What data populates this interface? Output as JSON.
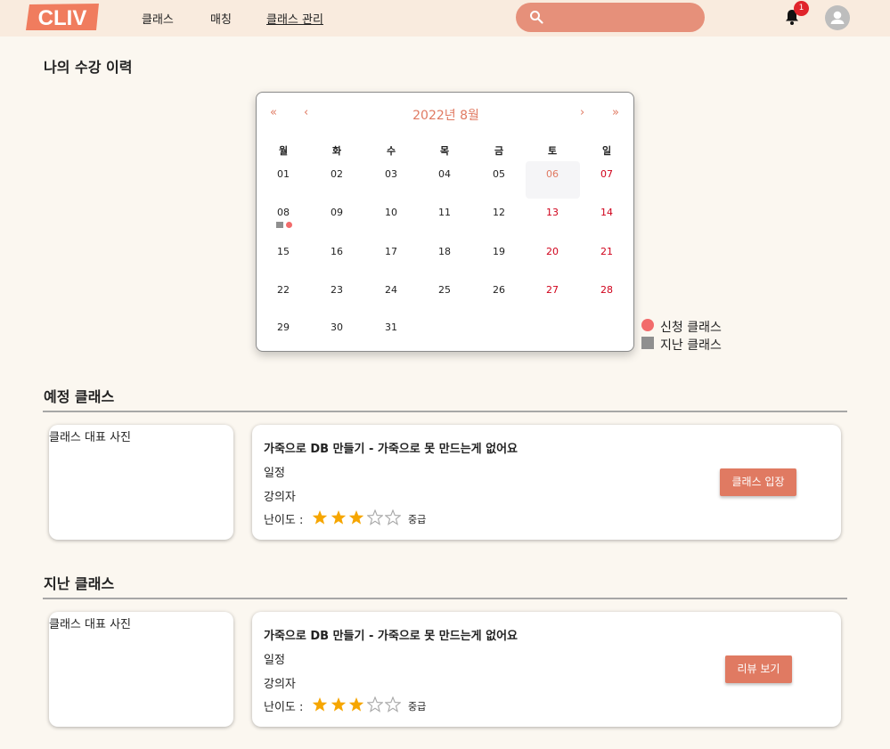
{
  "header": {
    "logo_text": "CLIV",
    "nav": [
      "클래스",
      "매칭",
      "클래스 관리"
    ],
    "notification_count": "1",
    "brand_color": "#e07a62"
  },
  "page_title": "나의 수강 이력",
  "calendar": {
    "prev_year": "«",
    "prev_month": "‹",
    "next_month": "›",
    "next_year": "»",
    "month_label": "2022년 8월",
    "weekdays": [
      "월",
      "화",
      "수",
      "목",
      "금",
      "토",
      "일"
    ],
    "weeks": [
      [
        "01",
        "02",
        "03",
        "04",
        "05",
        "06",
        "07"
      ],
      [
        "08",
        "09",
        "10",
        "11",
        "12",
        "13",
        "14"
      ],
      [
        "15",
        "16",
        "17",
        "18",
        "19",
        "20",
        "21"
      ],
      [
        "22",
        "23",
        "24",
        "25",
        "26",
        "27",
        "28"
      ],
      [
        "29",
        "30",
        "31",
        "",
        "",
        "",
        ""
      ]
    ]
  },
  "legend": {
    "applied": "신청 클래스",
    "past": "지난 클래스",
    "applied_color": "#f26b6b",
    "past_color": "#8f8f8f"
  },
  "upcoming": {
    "section_title": "예정 클래스",
    "photo_label": "클래스 대표 사진",
    "title": "가죽으로 DB 만들기 - 가죽으로 못 만드는게 없어요",
    "schedule": "일정",
    "instructor": "강의자",
    "level_label": "난이도 :",
    "rating": 3,
    "rating_max": 5,
    "level_text": "중급",
    "button": "클래스 입장"
  },
  "past": {
    "section_title": "지난 클래스",
    "photo_label": "클래스 대표 사진",
    "title": "가죽으로 DB 만들기 - 가죽으로 못 만드는게 없어요",
    "schedule": "일정",
    "instructor": "강의자",
    "level_label": "난이도 :",
    "rating": 3,
    "rating_max": 5,
    "level_text": "중급",
    "button": "리뷰 보기"
  }
}
